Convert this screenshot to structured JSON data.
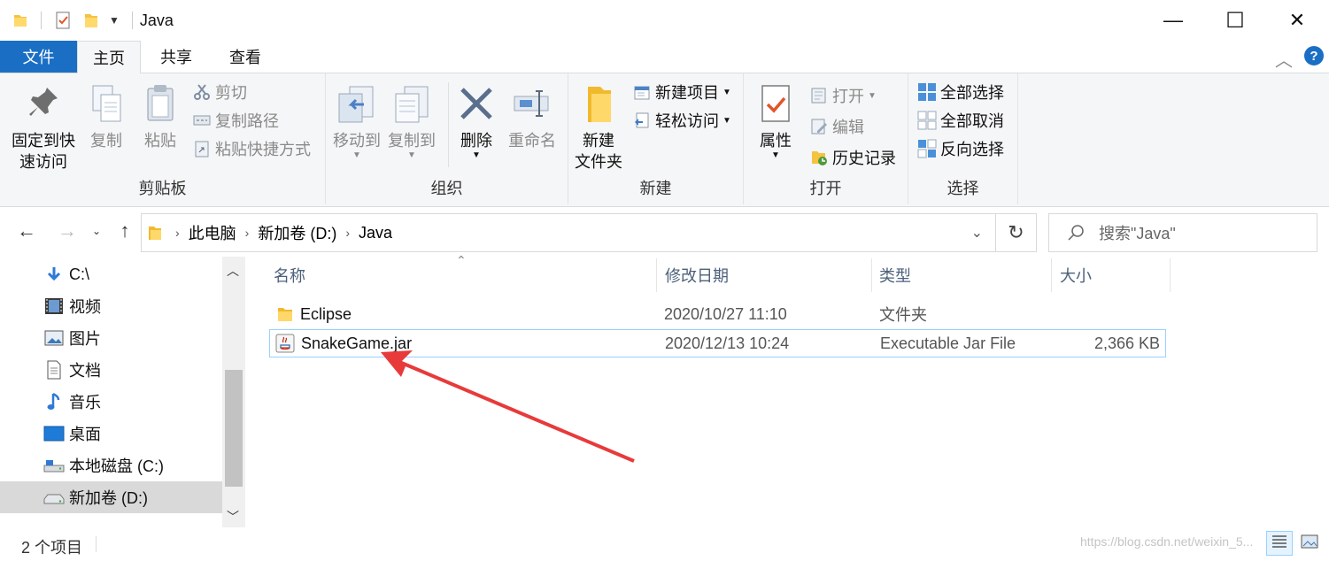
{
  "window": {
    "title": "Java",
    "minimize_glyph": "—",
    "maximize_glyph": "☐",
    "close_glyph": "✕"
  },
  "tabs": {
    "file": "文件",
    "home": "主页",
    "share": "共享",
    "view": "查看"
  },
  "ribbon": {
    "clipboard": {
      "title": "剪贴板",
      "pin_line1": "固定到快",
      "pin_line2": "速访问",
      "copy": "复制",
      "paste": "粘贴",
      "cut": "剪切",
      "copy_path": "复制路径",
      "paste_shortcut": "粘贴快捷方式"
    },
    "organize": {
      "title": "组织",
      "move_to": "移动到",
      "copy_to": "复制到",
      "delete": "删除",
      "rename": "重命名"
    },
    "new": {
      "title": "新建",
      "new_folder_line1": "新建",
      "new_folder_line2": "文件夹",
      "new_item": "新建项目",
      "easy_access": "轻松访问"
    },
    "open": {
      "title": "打开",
      "properties": "属性",
      "open": "打开",
      "edit": "编辑",
      "history": "历史记录"
    },
    "select": {
      "title": "选择",
      "select_all": "全部选择",
      "select_none": "全部取消",
      "invert": "反向选择"
    }
  },
  "address": {
    "crumbs": [
      "此电脑",
      "新加卷 (D:)",
      "Java"
    ],
    "search_placeholder": "搜索\"Java\""
  },
  "nav_items": [
    {
      "label": "C:\\",
      "icon": "download-arrow-icon"
    },
    {
      "label": "视频",
      "icon": "video-icon"
    },
    {
      "label": "图片",
      "icon": "picture-icon"
    },
    {
      "label": "文档",
      "icon": "document-icon"
    },
    {
      "label": "音乐",
      "icon": "music-icon"
    },
    {
      "label": "桌面",
      "icon": "desktop-icon"
    },
    {
      "label": "本地磁盘 (C:)",
      "icon": "drive-icon"
    },
    {
      "label": "新加卷 (D:)",
      "icon": "drive-icon",
      "selected": true
    }
  ],
  "columns": {
    "name": "名称",
    "modified": "修改日期",
    "type": "类型",
    "size": "大小"
  },
  "files": [
    {
      "name": "Eclipse",
      "modified": "2020/10/27 11:10",
      "type": "文件夹",
      "size": "",
      "icon": "folder-icon"
    },
    {
      "name": "SnakeGame.jar",
      "modified": "2020/12/13 10:24",
      "type": "Executable Jar File",
      "size": "2,366 KB",
      "icon": "jar-icon",
      "selected": true
    }
  ],
  "status": {
    "count": "2 个项目",
    "watermark": "https://blog.csdn.net/weixin_5..."
  },
  "colors": {
    "accent": "#1a6fc4",
    "annotation_arrow": "#e83a3a",
    "selection_border": "#99d1ff"
  }
}
